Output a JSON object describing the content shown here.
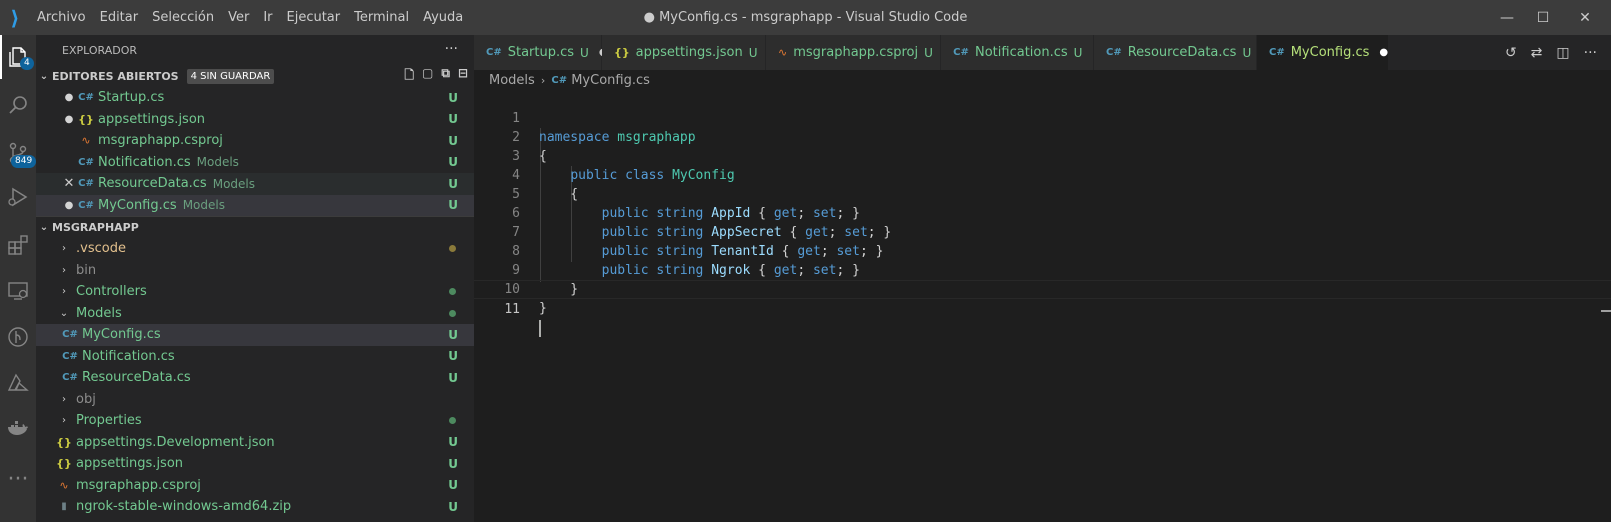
{
  "titlebar": {
    "menu": [
      "Archivo",
      "Editar",
      "Selección",
      "Ver",
      "Ir",
      "Ejecutar",
      "Terminal",
      "Ayuda"
    ],
    "title": "● MyConfig.cs - msgraphapp - Visual Studio Code"
  },
  "activitybar": {
    "explorer_badge": "4",
    "scm_badge": "849"
  },
  "sidebar": {
    "header": "EXPLORADOR",
    "more": "···",
    "open_editors": {
      "title": "EDITORES ABIERTOS",
      "badge": "4 SIN GUARDAR",
      "items": [
        {
          "name": "Startup.cs",
          "desc": "",
          "status": "U",
          "marker": "●"
        },
        {
          "name": "appsettings.json",
          "desc": "",
          "status": "U",
          "marker": "●"
        },
        {
          "name": "msgraphapp.csproj",
          "desc": "",
          "status": "U",
          "marker": ""
        },
        {
          "name": "Notification.cs",
          "desc": "Models",
          "status": "U",
          "marker": ""
        },
        {
          "name": "ResourceData.cs",
          "desc": "Models",
          "status": "U",
          "marker": "✕"
        },
        {
          "name": "MyConfig.cs",
          "desc": "Models",
          "status": "U",
          "marker": "●"
        }
      ]
    },
    "project": {
      "title": "MSGRAPHAPP",
      "items": [
        {
          "name": ".vscode"
        },
        {
          "name": "bin"
        },
        {
          "name": "Controllers"
        },
        {
          "name": "Models"
        },
        {
          "name": "MyConfig.cs",
          "status": "U"
        },
        {
          "name": "Notification.cs",
          "status": "U"
        },
        {
          "name": "ResourceData.cs",
          "status": "U"
        },
        {
          "name": "obj"
        },
        {
          "name": "Properties"
        },
        {
          "name": "appsettings.Development.json",
          "status": "U"
        },
        {
          "name": "appsettings.json",
          "status": "U"
        },
        {
          "name": "msgraphapp.csproj",
          "status": "U"
        },
        {
          "name": "ngrok-stable-windows-amd64.zip",
          "status": "U"
        }
      ]
    }
  },
  "tabs": [
    {
      "name": "Startup.cs",
      "status": "U",
      "dirty": "●"
    },
    {
      "name": "appsettings.json",
      "status": "U",
      "dirty": "●"
    },
    {
      "name": "msgraphapp.csproj",
      "status": "U",
      "dirty": ""
    },
    {
      "name": "Notification.cs",
      "status": "U",
      "dirty": ""
    },
    {
      "name": "ResourceData.cs",
      "status": "U",
      "dirty": "●"
    },
    {
      "name": "MyConfig.cs",
      "status": "",
      "dirty": "●"
    }
  ],
  "breadcrumb": [
    "Models",
    "MyConfig.cs"
  ],
  "code": {
    "line_numbers": [
      "1",
      "2",
      "3",
      "4",
      "5",
      "6",
      "7",
      "8",
      "9",
      "10",
      "11"
    ]
  },
  "colors": {
    "untracked_green": "#73c991",
    "keyword_blue": "#569cd6",
    "type_teal": "#4ec9b0",
    "accent": "#0e639c"
  }
}
